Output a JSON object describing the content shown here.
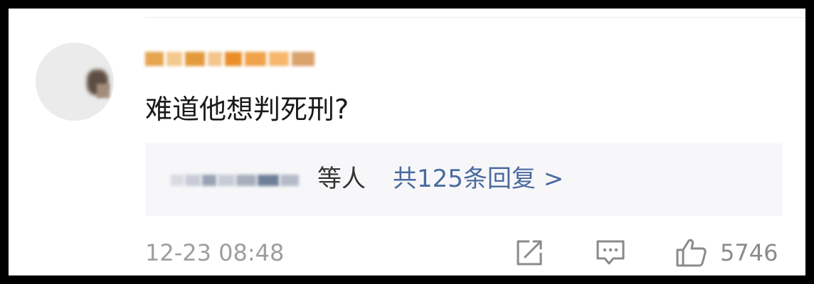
{
  "comment": {
    "text": "难道他想判死刑?",
    "replies": {
      "suffix": "等人",
      "count_label": "共125条回复 >"
    },
    "timestamp": "12-23 08:48",
    "like_count": "5746"
  },
  "icons": {
    "share": "share-icon",
    "reply": "comment-icon",
    "like": "thumbs-up-icon"
  },
  "colors": {
    "link": "#4a6a9f",
    "muted": "#9e9e9e",
    "reply_bg": "#f7f7f9"
  }
}
